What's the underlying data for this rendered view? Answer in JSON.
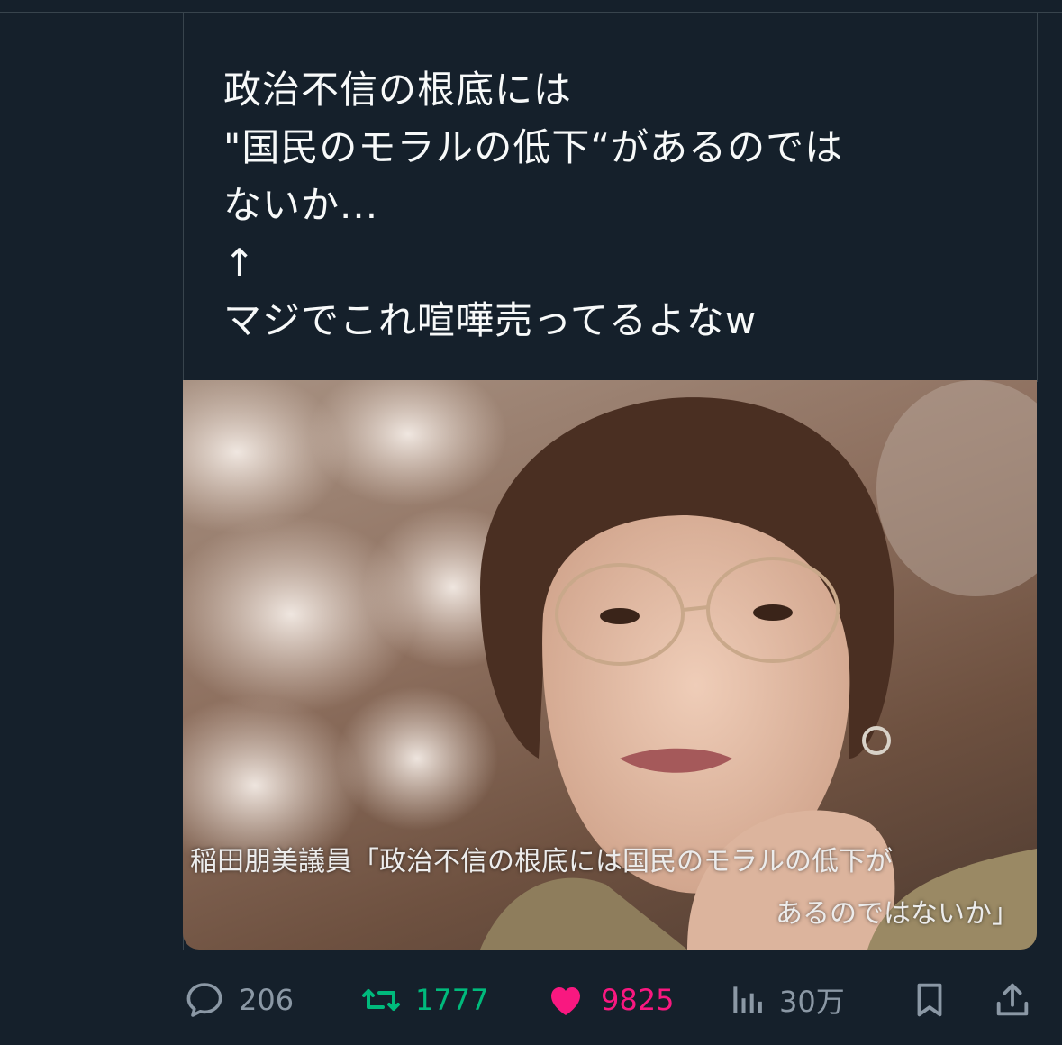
{
  "post": {
    "text_lines": [
      "政治不信の根底には",
      "\"国民のモラルの低下“があるのでは",
      "ないか...",
      "↑",
      "マジでこれ喧嘩売ってるよなw"
    ]
  },
  "media": {
    "caption_line1": "稲田朋美議員「政治不信の根底には国民のモラルの低下が",
    "caption_line2": "あるのではないか」"
  },
  "actions": {
    "reply_count": "206",
    "retweet_count": "1777",
    "like_count": "9825",
    "views_count": "30万"
  },
  "colors": {
    "background": "#15202b",
    "retweet": "#00ba7c",
    "like": "#f91880",
    "muted": "#8b98a5"
  }
}
